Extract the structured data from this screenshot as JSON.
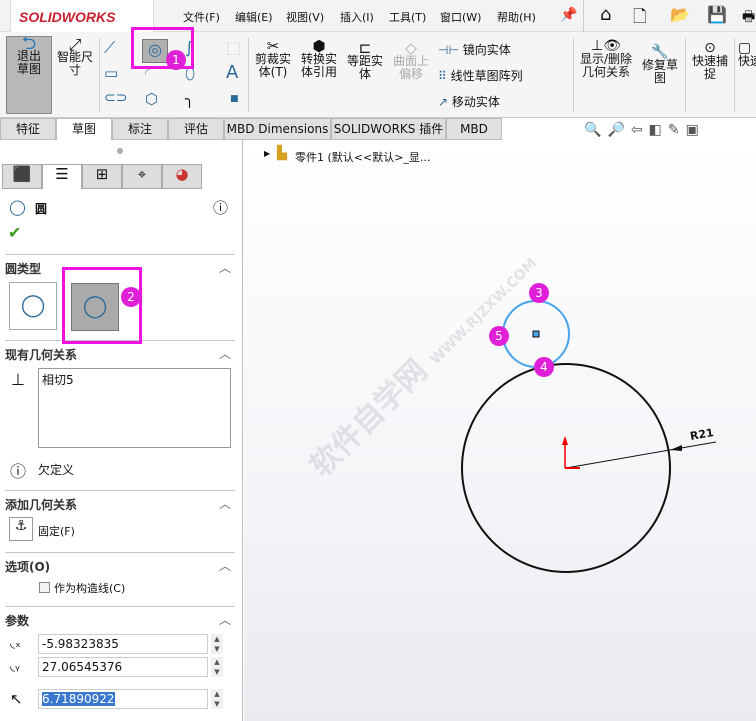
{
  "app": {
    "logo": "SOLIDWORKS"
  },
  "menu": [
    "文件(F)",
    "编辑(E)",
    "视图(V)",
    "插入(I)",
    "工具(T)",
    "窗口(W)",
    "帮助(H)"
  ],
  "ribbon": {
    "exit_sketch": "退出草图",
    "smart_dim": "智能尺寸",
    "trim": "剪裁实体(T)",
    "convert": "转换实体引用",
    "offset": "等距实体",
    "surface_offset": "曲面上偏移",
    "mirror": "镜向实体",
    "linear_pattern": "线性草图阵列",
    "move": "移动实体",
    "show_relations": "显示/删除几何关系",
    "repair": "修复草图",
    "quick_snap": "快速捕捉",
    "quick": "快速"
  },
  "tabs": [
    "特征",
    "草图",
    "标注",
    "评估",
    "MBD Dimensions",
    "SOLIDWORKS 插件",
    "MBD"
  ],
  "tree": {
    "part": "零件1 (默认<<默认>_显..."
  },
  "panel": {
    "title": "圆",
    "circle_type": "圆类型",
    "existing_relations": "现有几何关系",
    "relations": [
      "相切5"
    ],
    "status": "欠定义",
    "add_relations": "添加几何关系",
    "fix": "固定(F)",
    "options": "选项(O)",
    "construction": "作为构造线(C)",
    "params": "参数",
    "x": "-5.98323835",
    "y": "27.06545376",
    "r": "6.71890922"
  },
  "sketch": {
    "dimension": "R21",
    "watermark": "软件自学网",
    "watermark_url": "WWW.RJZXW.COM"
  },
  "markers": [
    "1",
    "2",
    "3",
    "4",
    "5"
  ],
  "colors": {
    "highlight": "#f010e0",
    "sketch_selected": "#4aa3ea"
  }
}
